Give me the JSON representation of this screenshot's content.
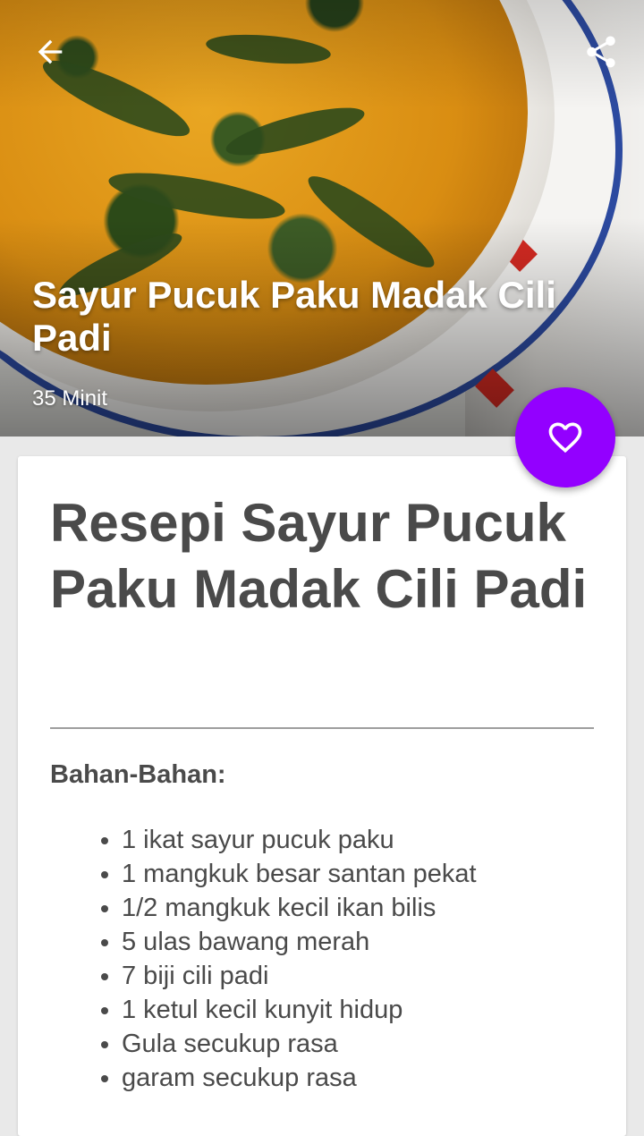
{
  "hero": {
    "title": "Sayur Pucuk Paku Madak Cili Padi",
    "time": "35 Minit",
    "back_icon": "arrow-left-icon",
    "share_icon": "share-icon"
  },
  "favorite": {
    "icon": "heart-outline-icon",
    "color": "#9300ff"
  },
  "recipe": {
    "title": "Resepi Sayur Pucuk Paku Madak Cili Padi",
    "ingredients_label": "Bahan-Bahan:",
    "ingredients": [
      "1 ikat sayur pucuk paku",
      "1 mangkuk besar santan pekat",
      "1/2 mangkuk kecil ikan bilis",
      "5 ulas bawang merah",
      "7 biji cili padi",
      "1 ketul kecil kunyit hidup",
      "Gula secukup rasa",
      "garam secukup rasa"
    ]
  }
}
